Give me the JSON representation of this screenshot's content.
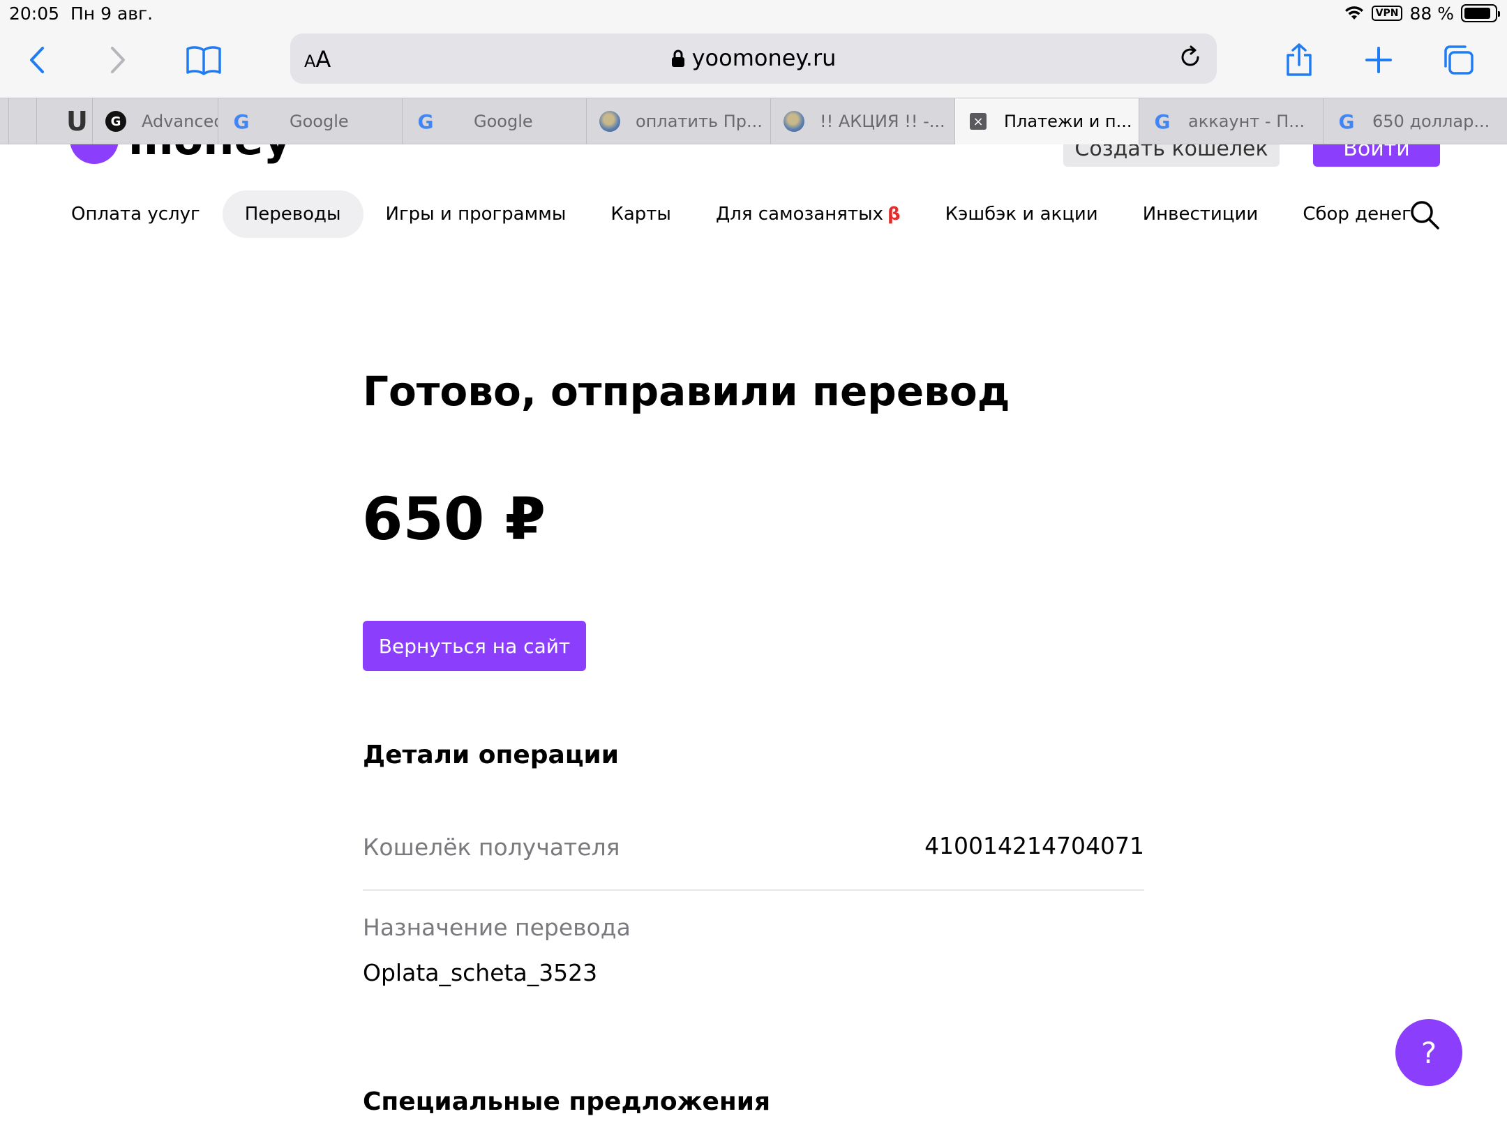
{
  "status_bar": {
    "time": "20:05",
    "date": "Пн 9 авг.",
    "vpn": "VPN",
    "battery": "88 %",
    "battery_level": 0.88
  },
  "browser": {
    "address": {
      "aa_small": "A",
      "aa_large": "A",
      "url": "yoomoney.ru"
    },
    "tabs": [
      {
        "label": "U",
        "icon": "u-favicon"
      },
      {
        "label": "Advanced",
        "icon": "dark-g-favicon"
      },
      {
        "label": "Google",
        "icon": "google-favicon"
      },
      {
        "label": "Google",
        "icon": "google-favicon"
      },
      {
        "label": "оплатить Пр...",
        "icon": "globe-favicon"
      },
      {
        "label": "!! АКЦИЯ !! -...",
        "icon": "globe-favicon"
      },
      {
        "label": "Платежи и п...",
        "icon": "close-icon",
        "active": true
      },
      {
        "label": "аккаунт - П...",
        "icon": "google-favicon"
      },
      {
        "label": "650 доллар...",
        "icon": "google-favicon"
      }
    ]
  },
  "header": {
    "logo_text": "money",
    "create_wallet_label": "Создать кошелёк",
    "login_label": "Войти"
  },
  "nav": {
    "items": [
      {
        "label": "Оплата услуг"
      },
      {
        "label": "Переводы",
        "active": true
      },
      {
        "label": "Игры и программы"
      },
      {
        "label": "Карты"
      },
      {
        "label": "Для самозанятых",
        "badge": "β"
      },
      {
        "label": "Кэшбэк и акции"
      },
      {
        "label": "Инвестиции"
      },
      {
        "label": "Сбор денег"
      }
    ]
  },
  "main": {
    "title": "Готово, отправили перевод",
    "amount": "650 ₽",
    "return_button": "Вернуться на сайт",
    "details_heading": "Детали операции",
    "recipient_wallet_label": "Кошелёк получателя",
    "recipient_wallet_value": "410014214704071",
    "purpose_label": "Назначение перевода",
    "purpose_value": "Oplata_scheta_3523",
    "special_offers_heading": "Специальные предложения"
  },
  "help": {
    "label": "?"
  },
  "colors": {
    "brand": "#8b3ffd",
    "safari_blue": "#1f7cf2",
    "beta": "#e32b2b"
  }
}
